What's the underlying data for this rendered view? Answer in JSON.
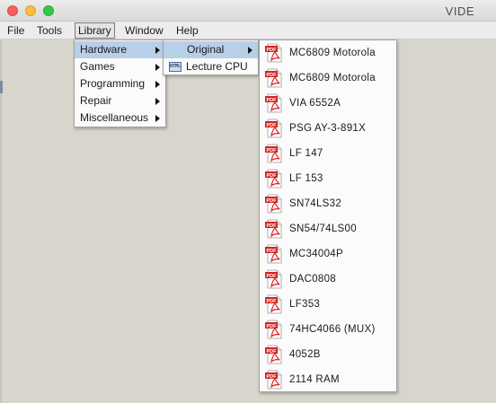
{
  "window": {
    "title": "VIDE"
  },
  "menubar": {
    "items": [
      {
        "label": "File"
      },
      {
        "label": "Tools"
      },
      {
        "label": "Library"
      },
      {
        "label": "Window"
      },
      {
        "label": "Help"
      }
    ]
  },
  "library_menu": {
    "items": [
      {
        "label": "Hardware"
      },
      {
        "label": "Games"
      },
      {
        "label": "Programming"
      },
      {
        "label": "Repair"
      },
      {
        "label": "Miscellaneous"
      }
    ]
  },
  "hardware_menu": {
    "items": [
      {
        "label": "Original"
      },
      {
        "label": "Lecture CPU",
        "icon": "html-icon",
        "icon_text": "HTML"
      }
    ]
  },
  "original_menu": {
    "icon": "pdf-icon",
    "icon_text": "PDF",
    "items": [
      {
        "label": "MC6809 Motorola"
      },
      {
        "label": "MC6809 Motorola"
      },
      {
        "label": "VIA 6552A"
      },
      {
        "label": "PSG AY-3-891X"
      },
      {
        "label": "LF 147"
      },
      {
        "label": "LF 153"
      },
      {
        "label": "SN74LS32"
      },
      {
        "label": "SN54/74LS00"
      },
      {
        "label": "MC34004P"
      },
      {
        "label": "DAC0808"
      },
      {
        "label": "LF353"
      },
      {
        "label": "74HC4066 (MUX)"
      },
      {
        "label": "4052B"
      },
      {
        "label": "2114 RAM"
      }
    ]
  },
  "colors": {
    "menu_highlight": "#b8cfe8",
    "pdf_red": "#d6231e",
    "desktop": "#d8d6cc"
  }
}
